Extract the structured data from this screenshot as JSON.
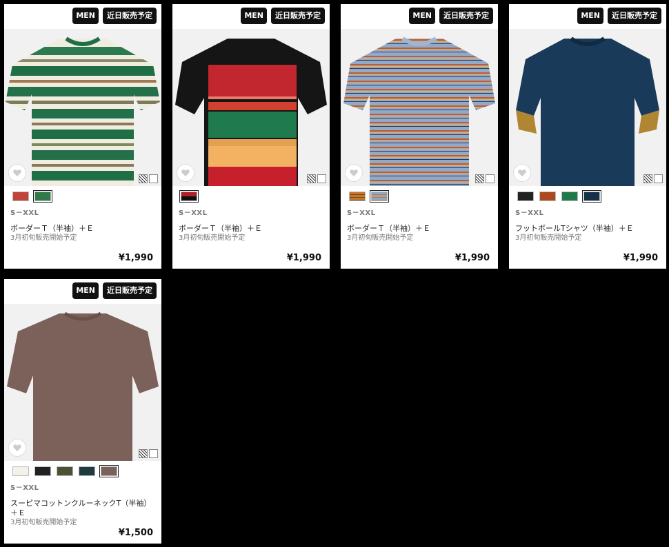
{
  "cards": [
    {
      "tags": [
        "MEN",
        "近日販売予定"
      ],
      "swatches": [
        "#c0443a",
        "#2f7a48"
      ],
      "selected_swatch": 1,
      "size": "S－XXL",
      "name": "ボーダーＴ（半袖）＋Ｅ",
      "note": "3月初旬販売開始予定",
      "price": "¥1,990"
    },
    {
      "tags": [
        "MEN",
        "近日販売予定"
      ],
      "swatches": [
        "#b21e2b"
      ],
      "selected_swatch": 0,
      "size": "S－XXL",
      "name": "ボーダーＴ（半袖）＋Ｅ",
      "note": "3月初旬販売開始予定",
      "price": "¥1,990"
    },
    {
      "tags": [
        "MEN",
        "近日販売予定"
      ],
      "swatches": [
        "#c9762a",
        "#8fa8c6"
      ],
      "selected_swatch": 1,
      "size": "S－XXL",
      "name": "ボーダーＴ（半袖）＋Ｅ",
      "note": "3月初旬販売開始予定",
      "price": "¥1,990"
    },
    {
      "tags": [
        "MEN",
        "近日販売予定"
      ],
      "swatches": [
        "#222222",
        "#a94a1f",
        "#1f7a4a",
        "#163049"
      ],
      "selected_swatch": 3,
      "size": "S－XXL",
      "name": "フットボールTシャツ（半袖）＋Ｅ",
      "note": "3月初旬販売開始予定",
      "price": "¥1,990"
    },
    {
      "tags": [
        "MEN",
        "近日販売予定"
      ],
      "swatches": [
        "#f4f1ea",
        "#222222",
        "#4d5236",
        "#1f3b3d",
        "#7b615a"
      ],
      "selected_swatch": 4,
      "size": "S－XXL",
      "name": "スーピマコットンクルーネックT（半袖）＋Ｅ",
      "note": "3月初旬販売開始予定",
      "price": "¥1,500"
    }
  ],
  "icons": {
    "favorite": "heart-plus-icon",
    "qr": "qr-code-icon"
  }
}
